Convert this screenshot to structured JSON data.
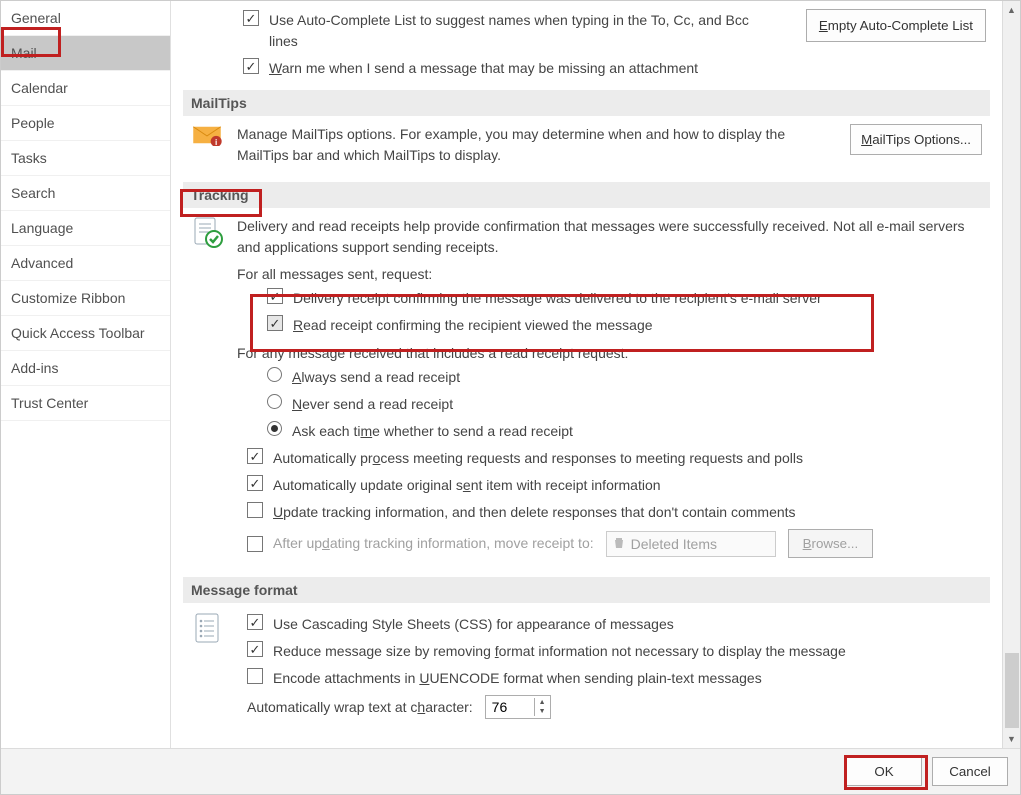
{
  "sidebar": {
    "items": [
      {
        "label": "General"
      },
      {
        "label": "Mail"
      },
      {
        "label": "Calendar"
      },
      {
        "label": "People"
      },
      {
        "label": "Tasks"
      },
      {
        "label": "Search"
      },
      {
        "label": "Language"
      },
      {
        "label": "Advanced"
      },
      {
        "label": "Customize Ribbon"
      },
      {
        "label": "Quick Access Toolbar"
      },
      {
        "label": "Add-ins"
      },
      {
        "label": "Trust Center"
      }
    ]
  },
  "top": {
    "autocomplete": "Use Auto-Complete List to suggest names when typing in the To, Cc, and Bcc lines",
    "empty_btn_pre": "E",
    "empty_btn_rest": "mpty Auto-Complete List",
    "warn_pre": "W",
    "warn_rest": "arn me when I send a message that may be missing an attachment"
  },
  "mailtips": {
    "header": "MailTips",
    "desc": "Manage MailTips options. For example, you may determine when and how to display the MailTips bar and which MailTips to display.",
    "btn_pre": "M",
    "btn_rest": "ailTips Options..."
  },
  "tracking": {
    "header": "Tracking",
    "desc": "Delivery and read receipts help provide confirmation that messages were successfully received. Not all e-mail servers and applications support sending receipts.",
    "for_all": "For all messages sent, request:",
    "delivery": "Delivery receipt confirming the message was delivered to the recipient's e-mail server",
    "read_pre": "R",
    "read_rest": "ead receipt confirming the recipient viewed the message",
    "for_any": "For any message received that includes a read receipt request:",
    "always_pre": "A",
    "always_rest": "lways send a read receipt",
    "never_pre": "N",
    "never_rest": "ever send a read receipt",
    "ask_pre": "Ask each ti",
    "ask_mn": "m",
    "ask_rest": "e whether to send a read receipt",
    "auto_proc_pre": "Automatically pr",
    "auto_proc_mn": "o",
    "auto_proc_rest": "cess meeting requests and responses to meeting requests and polls",
    "auto_upd_pre": "Automatically update original s",
    "auto_upd_mn": "e",
    "auto_upd_rest": "nt item with receipt information",
    "upd_track_pre": "U",
    "upd_track_rest": "pdate tracking information, and then delete responses that don't contain comments",
    "after_upd_pre": "After up",
    "after_upd_mn": "d",
    "after_upd_rest": "ating tracking information, move receipt to:",
    "deleted_items": "Deleted Items",
    "browse_pre": "B",
    "browse_rest": "rowse..."
  },
  "msgformat": {
    "header": "Message format",
    "css": "Use Cascading Style Sheets (CSS) for appearance of messages",
    "reduce_pre": "Reduce message size by removing ",
    "reduce_mn": "f",
    "reduce_rest": "ormat information not necessary to display the message",
    "encode_pre": "Encode attachments in ",
    "encode_mn": "U",
    "encode_rest": "UENCODE format when sending plain-text messages",
    "wrap_pre": "Automatically wrap text at c",
    "wrap_mn": "h",
    "wrap_rest": "aracter:",
    "wrap_val": "76"
  },
  "footer": {
    "ok": "OK",
    "cancel": "Cancel"
  }
}
